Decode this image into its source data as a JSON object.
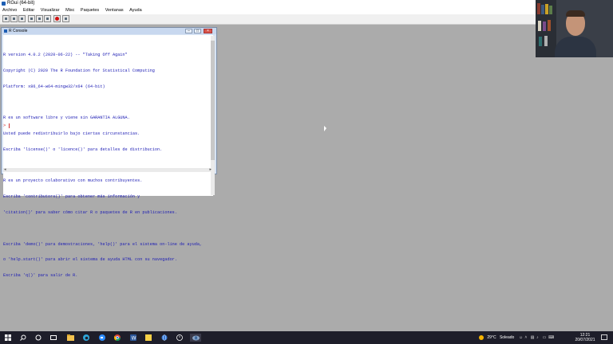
{
  "titlebar": {
    "title": "RGui (64-bit)"
  },
  "menu": [
    "Archivo",
    "Editar",
    "Visualizar",
    "Misc",
    "Paquetes",
    "Ventanas",
    "Ayuda"
  ],
  "toolbar": {
    "buttons": [
      "open-script-icon",
      "load-workspace-icon",
      "save-workspace-icon",
      "copy-icon",
      "paste-icon",
      "copy-paste-icon",
      "stop-icon",
      "print-icon"
    ]
  },
  "console": {
    "title": "R Console",
    "lines": [
      "R version 4.0.2 (2020-06-22) -- \"Taking Off Again\"",
      "Copyright (C) 2020 The R Foundation for Statistical Computing",
      "Platform: x86_64-w64-mingw32/x64 (64-bit)",
      "",
      "R es un software libre y viene sin GARANTIA ALGUNA.",
      "Usted puede redistribuirlo bajo ciertas circunstancias.",
      "Escriba 'license()' o 'licence()' para detalles de distribucion.",
      "",
      "R es un proyecto colaborativo con muchos contribuyentes.",
      "Escriba 'contributors()' para obtener más información y",
      "'citation()' para saber cómo citar R o paquetes de R en publicaciones.",
      "",
      "Escriba 'demo()' para demostraciones, 'help()' para el sistema on-line de ayuda,",
      "o 'help.start()' para abrir el sistema de ayuda HTML con su navegador.",
      "Escriba 'q()' para salir de R."
    ],
    "prompt": ">"
  },
  "taskbar": {
    "weather": {
      "temp": "29°C",
      "condition": "Soleado"
    },
    "time": "12:21",
    "date": "20/07/2021"
  },
  "colors": {
    "console_text": "#1c1cb4",
    "prompt": "#d23030",
    "mdi_background": "#ababab",
    "taskbar": "#1e1e2a"
  }
}
